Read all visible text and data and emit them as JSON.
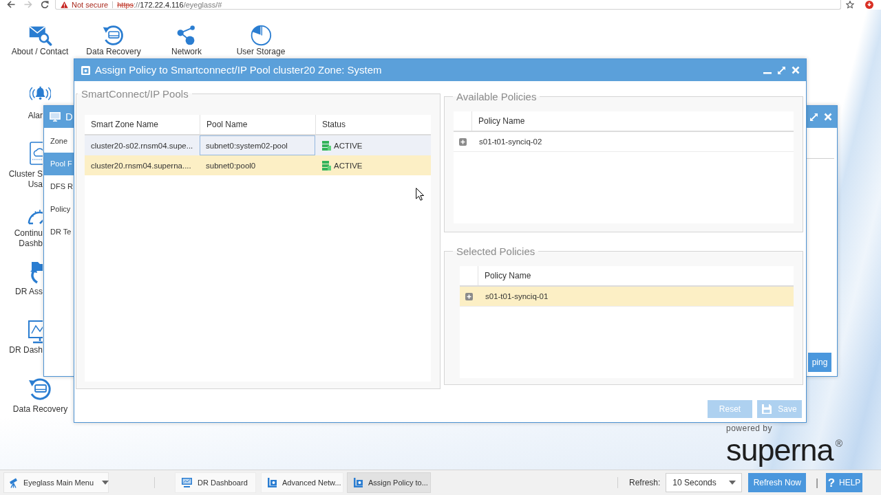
{
  "browser": {
    "security_label": "Not secure",
    "insecure": true,
    "url_parts": [
      {
        "kind": "scheme",
        "text": "https"
      },
      {
        "kind": "dim",
        "text": "://"
      },
      {
        "kind": "host",
        "text": "172.22.4.116"
      },
      {
        "kind": "dim",
        "text": "/eyeglass/#"
      }
    ]
  },
  "desktop": {
    "top_icons": [
      {
        "kind": "mail",
        "label": "About / Contact"
      },
      {
        "kind": "recovery",
        "label": "Data Recovery"
      },
      {
        "kind": "network",
        "label": "Network"
      },
      {
        "kind": "storage",
        "label": "User Storage"
      }
    ],
    "side_icons": [
      {
        "kind": "alarm",
        "label": "Alar"
      },
      {
        "kind": "cluster",
        "label": "Cluster S\nUsa"
      },
      {
        "kind": "gauge",
        "label": "Continu\nDashb"
      },
      {
        "kind": "assistant",
        "label": "DR Ass"
      },
      {
        "kind": "dashboard",
        "label": "DR Dash"
      },
      {
        "kind": "recovery",
        "label": "Data Recovery"
      }
    ],
    "logo": {
      "tagline": "powered by",
      "name": "superna$^{®}$"
    }
  },
  "background_window": {
    "title": "D",
    "nav": [
      {
        "label": "Zone",
        "selected": false
      },
      {
        "label": "Pool F",
        "selected": true
      },
      {
        "label": "DFS R",
        "selected": false
      },
      {
        "label": "Policy",
        "selected": false
      },
      {
        "label": "DR Te",
        "selected": false
      }
    ],
    "action_button": "ping"
  },
  "dialog": {
    "title": "Assign Policy to Smartconnect/IP Pool cluster20 Zone: System",
    "pools": {
      "legend": "SmartConnect/IP Pools",
      "columns": [
        "Smart Zone Name",
        "Pool Name",
        "Status"
      ],
      "rows": [
        {
          "zone": "cluster20-s02.rnsm04.supe...",
          "pool": "subnet0:system02-pool",
          "status": "ACTIVE",
          "selected": false,
          "focused": true
        },
        {
          "zone": "cluster20.rnsm04.superna....",
          "pool": "subnet0:pool0",
          "status": "ACTIVE",
          "selected": true,
          "focused": false
        }
      ]
    },
    "available": {
      "legend": "Available Policies",
      "column": "Policy Name",
      "rows": [
        {
          "name": "s01-t01-synciq-02",
          "selected": false
        }
      ]
    },
    "chosen": {
      "legend": "Selected Policies",
      "column": "Policy Name",
      "rows": [
        {
          "name": "s01-t01-synciq-01",
          "selected": true
        }
      ]
    },
    "buttons": [
      {
        "kind": "reset",
        "label": "Reset",
        "disabled": true
      },
      {
        "kind": "save",
        "label": "Save",
        "disabled": true
      }
    ]
  },
  "taskbar": {
    "menu": "Eyeglass Main Menu",
    "tasks": [
      {
        "kind": "dashboard",
        "label": "DR Dashboard",
        "selected": false
      },
      {
        "kind": "window",
        "label": "Advanced Netw...",
        "selected": false
      },
      {
        "kind": "window",
        "label": "Assign Policy to...",
        "selected": true
      }
    ],
    "refresh_label": "Refresh:",
    "refresh_interval": "10 Seconds",
    "refresh_button": "Refresh Now",
    "divider": "|",
    "help_icon": "?",
    "help_label": "HELP"
  }
}
